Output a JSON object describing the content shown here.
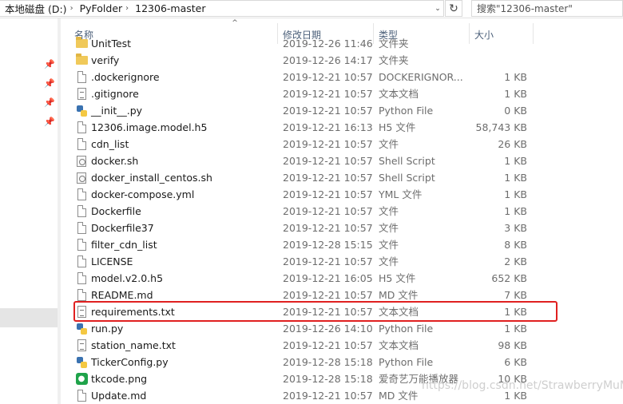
{
  "address": {
    "crumbs": [
      "本地磁盘 (D:)",
      "PyFolder",
      "12306-master"
    ],
    "separator": "›",
    "dropdown_glyph": "⌄",
    "refresh_glyph": "↻"
  },
  "search": {
    "placeholder": "搜索\"12306-master\""
  },
  "columns": {
    "name": "名称",
    "date": "修改日期",
    "type": "类型",
    "size": "大小"
  },
  "sort_glyph": "^",
  "files": [
    {
      "name": "UnitTest",
      "date": "2019-12-26 11:46",
      "type": "文件夹",
      "size": "",
      "icon": "folder-icon"
    },
    {
      "name": "verify",
      "date": "2019-12-26 14:17",
      "type": "文件夹",
      "size": "",
      "icon": "folder-icon"
    },
    {
      "name": ".dockerignore",
      "date": "2019-12-21 10:57",
      "type": "DOCKERIGNOR...",
      "size": "1 KB",
      "icon": "file-icon"
    },
    {
      "name": ".gitignore",
      "date": "2019-12-21 10:57",
      "type": "文本文档",
      "size": "1 KB",
      "icon": "text-file-icon"
    },
    {
      "name": "__init__.py",
      "date": "2019-12-21 10:57",
      "type": "Python File",
      "size": "0 KB",
      "icon": "python-file-icon"
    },
    {
      "name": "12306.image.model.h5",
      "date": "2019-12-21 16:13",
      "type": "H5 文件",
      "size": "58,743 KB",
      "icon": "file-icon"
    },
    {
      "name": "cdn_list",
      "date": "2019-12-21 10:57",
      "type": "文件",
      "size": "26 KB",
      "icon": "file-icon"
    },
    {
      "name": "docker.sh",
      "date": "2019-12-21 10:57",
      "type": "Shell Script",
      "size": "1 KB",
      "icon": "shell-script-icon"
    },
    {
      "name": "docker_install_centos.sh",
      "date": "2019-12-21 10:57",
      "type": "Shell Script",
      "size": "1 KB",
      "icon": "shell-script-icon"
    },
    {
      "name": "docker-compose.yml",
      "date": "2019-12-21 10:57",
      "type": "YML 文件",
      "size": "1 KB",
      "icon": "file-icon"
    },
    {
      "name": "Dockerfile",
      "date": "2019-12-21 10:57",
      "type": "文件",
      "size": "1 KB",
      "icon": "file-icon"
    },
    {
      "name": "Dockerfile37",
      "date": "2019-12-21 10:57",
      "type": "文件",
      "size": "3 KB",
      "icon": "file-icon"
    },
    {
      "name": "filter_cdn_list",
      "date": "2019-12-28 15:15",
      "type": "文件",
      "size": "8 KB",
      "icon": "file-icon"
    },
    {
      "name": "LICENSE",
      "date": "2019-12-21 10:57",
      "type": "文件",
      "size": "2 KB",
      "icon": "file-icon"
    },
    {
      "name": "model.v2.0.h5",
      "date": "2019-12-21 16:05",
      "type": "H5 文件",
      "size": "652 KB",
      "icon": "file-icon"
    },
    {
      "name": "README.md",
      "date": "2019-12-21 10:57",
      "type": "MD 文件",
      "size": "7 KB",
      "icon": "file-icon"
    },
    {
      "name": "requirements.txt",
      "date": "2019-12-21 10:57",
      "type": "文本文档",
      "size": "1 KB",
      "icon": "text-file-icon"
    },
    {
      "name": "run.py",
      "date": "2019-12-26 14:10",
      "type": "Python File",
      "size": "1 KB",
      "icon": "python-file-icon"
    },
    {
      "name": "station_name.txt",
      "date": "2019-12-21 10:57",
      "type": "文本文档",
      "size": "98 KB",
      "icon": "text-file-icon"
    },
    {
      "name": "TickerConfig.py",
      "date": "2019-12-28 15:18",
      "type": "Python File",
      "size": "6 KB",
      "icon": "python-file-icon"
    },
    {
      "name": "tkcode.png",
      "date": "2019-12-28 15:18",
      "type": "爱奇艺万能播放器",
      "size": "10 KB",
      "icon": "image-file-icon"
    },
    {
      "name": "Update.md",
      "date": "2019-12-21 10:57",
      "type": "MD 文件",
      "size": "1 KB",
      "icon": "file-icon"
    }
  ],
  "highlighted_file": "requirements.txt",
  "highlight_color": "#e02020",
  "pin_glyph": "📌",
  "watermark": "https://blog.csdn.net/StrawberryMuMu"
}
